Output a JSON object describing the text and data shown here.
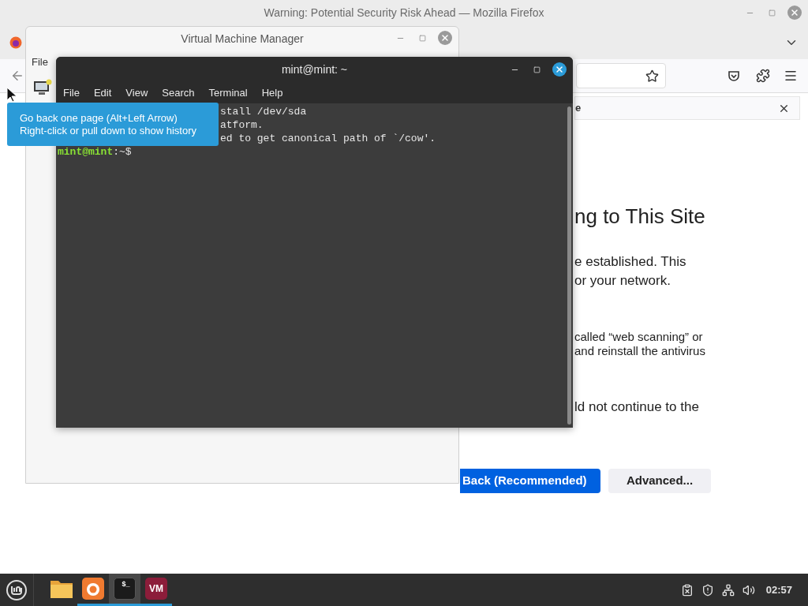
{
  "firefox": {
    "title": "Warning: Potential Security Risk Ahead — Mozilla Firefox",
    "notification": "e",
    "heading": "ng to This Site",
    "paragraphs": [
      {
        "kind": "large",
        "lines": [
          "e established. This",
          "or your network."
        ]
      },
      {
        "kind": "small",
        "lines": [
          "called “web scanning” or",
          "and reinstall the antivirus"
        ]
      },
      {
        "kind": "large",
        "lines": [
          "ld not continue to the"
        ]
      }
    ],
    "buttons": [
      {
        "label": "Back (Recommended)",
        "kind": "primary"
      },
      {
        "label": "Advanced...",
        "kind": "secondary"
      }
    ],
    "tooltip": [
      "Go back one page (Alt+Left Arrow)",
      "Right-click or pull down to show history"
    ]
  },
  "vmm": {
    "title": "Virtual Machine Manager",
    "menu": [
      "File"
    ]
  },
  "terminal": {
    "title": "mint@mint: ~",
    "menu": [
      "File",
      "Edit",
      "View",
      "Search",
      "Terminal",
      "Help"
    ],
    "lines": [
      "stall /dev/sda",
      "atform.",
      "ed to get canonical path of `/cow'."
    ],
    "prompt": {
      "user": "mint@mint",
      "path": ":~$"
    }
  },
  "taskbar": {
    "apps": [
      {
        "kind": "files",
        "running": false,
        "selected": false
      },
      {
        "kind": "firefox",
        "running": true,
        "selected": false
      },
      {
        "kind": "terminal",
        "label": "$_",
        "running": true,
        "selected": true
      },
      {
        "kind": "vm",
        "label": "VM",
        "running": true,
        "selected": false
      }
    ],
    "clock": "02:57"
  }
}
